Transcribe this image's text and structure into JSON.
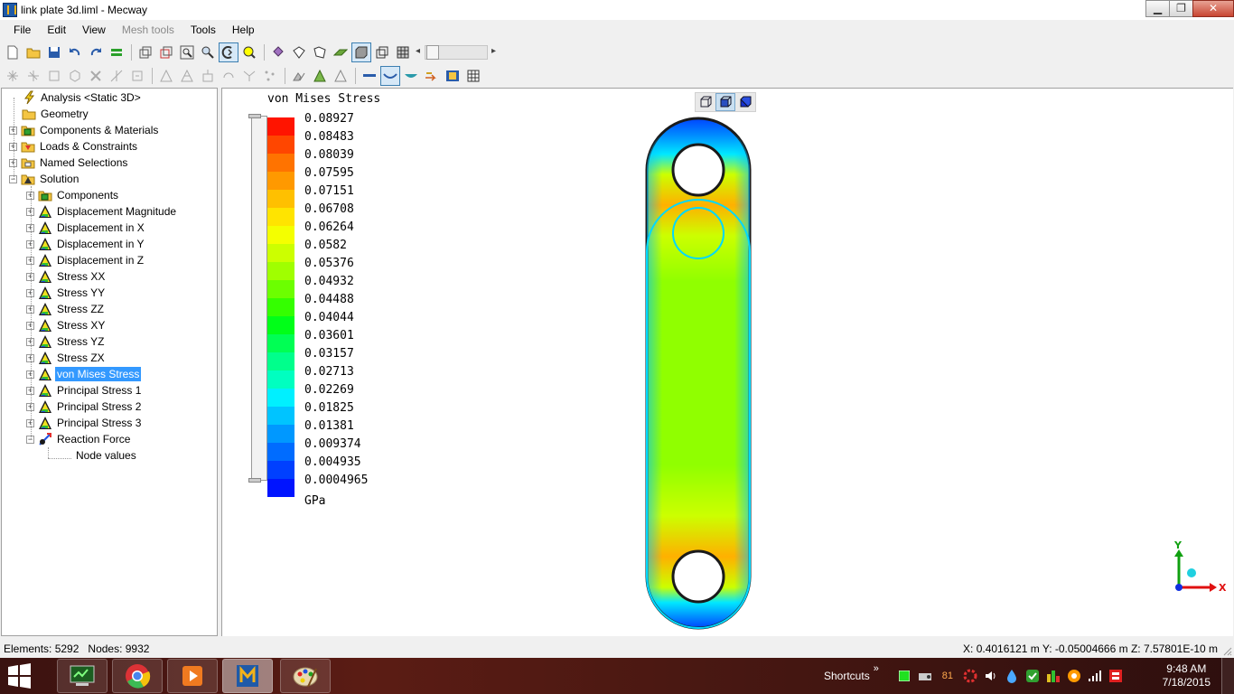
{
  "window": {
    "title": "link plate 3d.liml - Mecway",
    "minimize": "▁",
    "maximize": "❐",
    "close": "✕"
  },
  "menu": [
    {
      "label": "File",
      "enabled": true
    },
    {
      "label": "Edit",
      "enabled": true
    },
    {
      "label": "View",
      "enabled": true
    },
    {
      "label": "Mesh tools",
      "enabled": false
    },
    {
      "label": "Tools",
      "enabled": true
    },
    {
      "label": "Help",
      "enabled": true
    }
  ],
  "toolbar1": [
    "new-file-icon",
    "open-folder-icon",
    "save-icon",
    "undo-icon",
    "redo-icon",
    "equals-icon",
    "sep",
    "copy-cube-icon",
    "cube-wire-icon",
    "zoom-box-icon",
    "zoom-icon",
    "zoom-pan-icon",
    "zoom-fit-icon",
    "sep",
    "paint-bucket-icon",
    "select-box-icon",
    "select-poly-icon",
    "layer-icon",
    "solid-cube-icon",
    "wire-cube-icon",
    "mesh-cube-icon"
  ],
  "toolbar2": [
    "node-icon",
    "node-merge-icon",
    "element-square-icon",
    "element-cube-icon",
    "delete-icon",
    "split-icon",
    "edit-icon",
    "sep",
    "refine-icon",
    "smooth-icon",
    "extrude-icon",
    "revolve-icon",
    "tri-split-icon",
    "node-scatter-icon",
    "sep",
    "mirror-icon",
    "pyramid-icon",
    "triangle-icon",
    "sep",
    "line-icon",
    "deformed-shape-icon",
    "shading-icon",
    "arrow-icon",
    "animation-icon",
    "table-icon"
  ],
  "tree": [
    {
      "label": "Analysis <Static 3D>",
      "icon": "analysis-bolt-icon",
      "level": 0,
      "expander": ""
    },
    {
      "label": "Geometry",
      "icon": "folder-icon",
      "level": 0,
      "expander": ""
    },
    {
      "label": "Components & Materials",
      "icon": "components-icon",
      "level": 0,
      "expander": "+"
    },
    {
      "label": "Loads & Constraints",
      "icon": "loads-icon",
      "level": 0,
      "expander": "+"
    },
    {
      "label": "Named Selections",
      "icon": "named-selection-icon",
      "level": 0,
      "expander": "+"
    },
    {
      "label": "Solution",
      "icon": "solution-icon",
      "level": 0,
      "expander": "−"
    },
    {
      "label": "Components",
      "icon": "components-icon",
      "level": 1,
      "expander": "+"
    },
    {
      "label": "Displacement Magnitude",
      "icon": "result-triangle-icon",
      "level": 1,
      "expander": "+"
    },
    {
      "label": "Displacement in X",
      "icon": "result-triangle-icon",
      "level": 1,
      "expander": "+"
    },
    {
      "label": "Displacement in Y",
      "icon": "result-triangle-icon",
      "level": 1,
      "expander": "+"
    },
    {
      "label": "Displacement in Z",
      "icon": "result-triangle-icon",
      "level": 1,
      "expander": "+"
    },
    {
      "label": "Stress XX",
      "icon": "result-triangle-icon",
      "level": 1,
      "expander": "+"
    },
    {
      "label": "Stress YY",
      "icon": "result-triangle-icon",
      "level": 1,
      "expander": "+"
    },
    {
      "label": "Stress ZZ",
      "icon": "result-triangle-icon",
      "level": 1,
      "expander": "+"
    },
    {
      "label": "Stress XY",
      "icon": "result-triangle-icon",
      "level": 1,
      "expander": "+"
    },
    {
      "label": "Stress YZ",
      "icon": "result-triangle-icon",
      "level": 1,
      "expander": "+"
    },
    {
      "label": "Stress ZX",
      "icon": "result-triangle-icon",
      "level": 1,
      "expander": "+"
    },
    {
      "label": "von Mises Stress",
      "icon": "result-triangle-icon",
      "level": 1,
      "expander": "+",
      "selected": true
    },
    {
      "label": "Principal Stress 1",
      "icon": "result-triangle-icon",
      "level": 1,
      "expander": "+"
    },
    {
      "label": "Principal Stress 2",
      "icon": "result-triangle-icon",
      "level": 1,
      "expander": "+"
    },
    {
      "label": "Principal Stress 3",
      "icon": "result-triangle-icon",
      "level": 1,
      "expander": "+"
    },
    {
      "label": "Reaction Force",
      "icon": "reaction-force-icon",
      "level": 1,
      "expander": "−"
    },
    {
      "label": "Node values",
      "icon": "",
      "level": 2,
      "expander": ""
    }
  ],
  "legend": {
    "title": "von Mises Stress",
    "unit": "GPa",
    "values": [
      "0.08927",
      "0.08483",
      "0.08039",
      "0.07595",
      "0.07151",
      "0.06708",
      "0.06264",
      "0.0582",
      "0.05376",
      "0.04932",
      "0.04488",
      "0.04044",
      "0.03601",
      "0.03157",
      "0.02713",
      "0.02269",
      "0.01825",
      "0.01381",
      "0.009374",
      "0.004935",
      "0.0004965"
    ],
    "colors": [
      "#ff1400",
      "#ff4600",
      "#ff7300",
      "#ff9900",
      "#ffc000",
      "#ffe400",
      "#f4ff00",
      "#ccff00",
      "#a0ff00",
      "#6cff00",
      "#34ff00",
      "#00ff18",
      "#00ff54",
      "#00ff8c",
      "#00ffc0",
      "#00f0ff",
      "#00c4ff",
      "#0098ff",
      "#006cff",
      "#0040ff",
      "#0014ff"
    ]
  },
  "view_buttons": [
    "view-wire-cube-icon",
    "view-half-cube-icon",
    "view-solid-cube-icon"
  ],
  "axes": {
    "x": "X",
    "y": "Y"
  },
  "status": {
    "elements": "Elements:  5292",
    "nodes": "Nodes: 9932",
    "coords": "X: 0.4016121 m Y: -0.05004666 m Z: 7.57801E-10 m"
  },
  "taskbar": {
    "apps": [
      "terminal-app-icon",
      "chrome-icon",
      "media-player-icon",
      "mecway-icon",
      "paint-icon"
    ],
    "shortcuts": "Shortcuts",
    "shortcuts_arrow": "»",
    "tray_number": "81",
    "time": "9:48 AM",
    "date": "7/18/2015"
  },
  "colors": {
    "selection": "#3399ff",
    "taskbar": "#4a1812",
    "plate_outline": "#1a1a1a",
    "plate_edge": "#00c8ff"
  }
}
